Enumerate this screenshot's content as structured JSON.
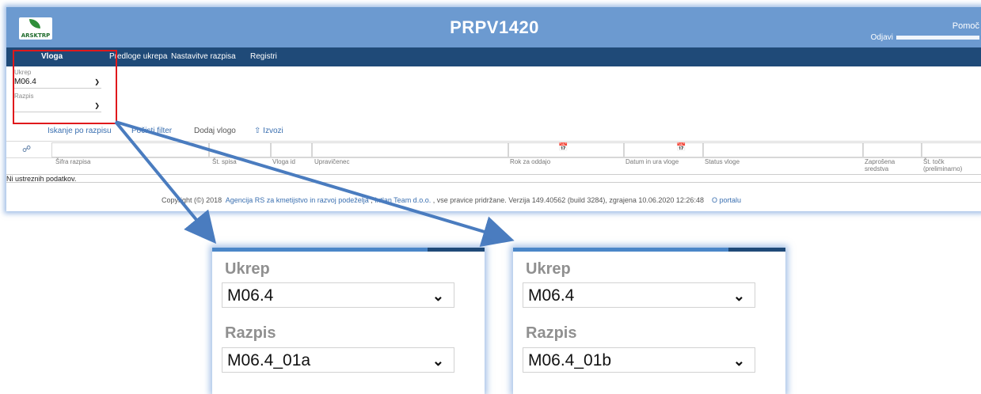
{
  "header": {
    "logo_text": "ARSKTRP",
    "title": "PRPV1420",
    "help": "Pomoč",
    "logout": "Odjavi"
  },
  "menu": {
    "items": [
      {
        "label": "Vloga",
        "active": true
      },
      {
        "label": "Predloge ukrepa"
      },
      {
        "label": "Nastavitve razpisa"
      },
      {
        "label": "Registri"
      }
    ]
  },
  "filters": {
    "ukrep_label": "Ukrep",
    "ukrep_value": "M06.4",
    "razpis_label": "Razpis",
    "razpis_value": ""
  },
  "toolbar": {
    "search": "Iskanje po razpisu",
    "clear": "Počisti filter",
    "add": "Dodaj vlogo",
    "export": "Izvozi"
  },
  "grid": {
    "columns": [
      "Šifra razpisa",
      "Št. spisa",
      "Vloga id",
      "Upravičenec",
      "Rok za oddajo",
      "Datum in ura vloge",
      "Status vloge",
      "Zaprošena sredstva",
      "Št. točk (preliminarno)"
    ],
    "empty_message": "Ni ustreznih podatkov."
  },
  "footer": {
    "copyright": "Copyright (©) 2018",
    "agency": "Agencija RS za kmetijstvo in razvoj podeželja",
    "vendor": "Ixtlan Team d.o.o.",
    "rights": ", vse pravice pridržane. Verzija 149.40562 (build 3284), zgrajena 10.06.2020 12:26:48",
    "portal": "O portalu"
  },
  "zoom_left": {
    "ukrep_label": "Ukrep",
    "ukrep_value": "M06.4",
    "razpis_label": "Razpis",
    "razpis_value": "M06.4_01a"
  },
  "zoom_right": {
    "ukrep_label": "Ukrep",
    "ukrep_value": "M06.4",
    "razpis_label": "Razpis",
    "razpis_value": "M06.4_01b"
  },
  "colors": {
    "topbar": "#6c9ad0",
    "menubar": "#1f4a78",
    "highlight": "#e0191c",
    "arrow": "#4a7cbf"
  }
}
